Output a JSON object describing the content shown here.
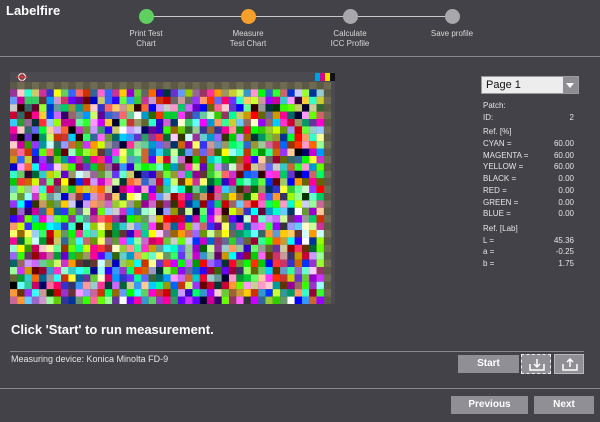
{
  "app": {
    "title": "Labelfire"
  },
  "steps": [
    {
      "line1": "Print Test",
      "line2": "Chart",
      "state": "done",
      "color": "#5fcf5f"
    },
    {
      "line1": "Measure",
      "line2": "Test Chart",
      "state": "current",
      "color": "#f5a02a"
    },
    {
      "line1": "Calculate",
      "line2": "ICC Profile",
      "state": "pending",
      "color": "#a8a8ac"
    },
    {
      "line1": "Save profile",
      "line2": "",
      "state": "pending",
      "color": "#a8a8ac"
    }
  ],
  "page_select": {
    "value": "Page 1"
  },
  "patch": {
    "heading": "Patch:",
    "id_label": "ID:",
    "id_value": "2",
    "ref_pct_heading": "Ref. [%]",
    "pct": [
      {
        "label": "CYAN =",
        "value": "60.00"
      },
      {
        "label": "MAGENTA =",
        "value": "60.00"
      },
      {
        "label": "YELLOW =",
        "value": "60.00"
      },
      {
        "label": "BLACK =",
        "value": "0.00"
      },
      {
        "label": "RED =",
        "value": "0.00"
      },
      {
        "label": "GREEN =",
        "value": "0.00"
      },
      {
        "label": "BLUE =",
        "value": "0.00"
      }
    ],
    "ref_lab_heading": "Ref. [Lab]",
    "lab": [
      {
        "label": "L =",
        "value": "45.36"
      },
      {
        "label": "a =",
        "value": "-0.25"
      },
      {
        "label": "b =",
        "value": "1.75"
      }
    ]
  },
  "instruction": "Click 'Start' to run measurement.",
  "device": "Measuring device: Konica Minolta FD-9",
  "buttons": {
    "start": "Start",
    "previous": "Previous",
    "next": "Next"
  },
  "icons": {
    "import": "import-icon",
    "export": "export-icon"
  },
  "colors": {
    "background": "#424248",
    "done": "#5fcf5f",
    "current": "#f5a02a",
    "pending": "#a8a8ac",
    "button": "#8f8f95"
  }
}
